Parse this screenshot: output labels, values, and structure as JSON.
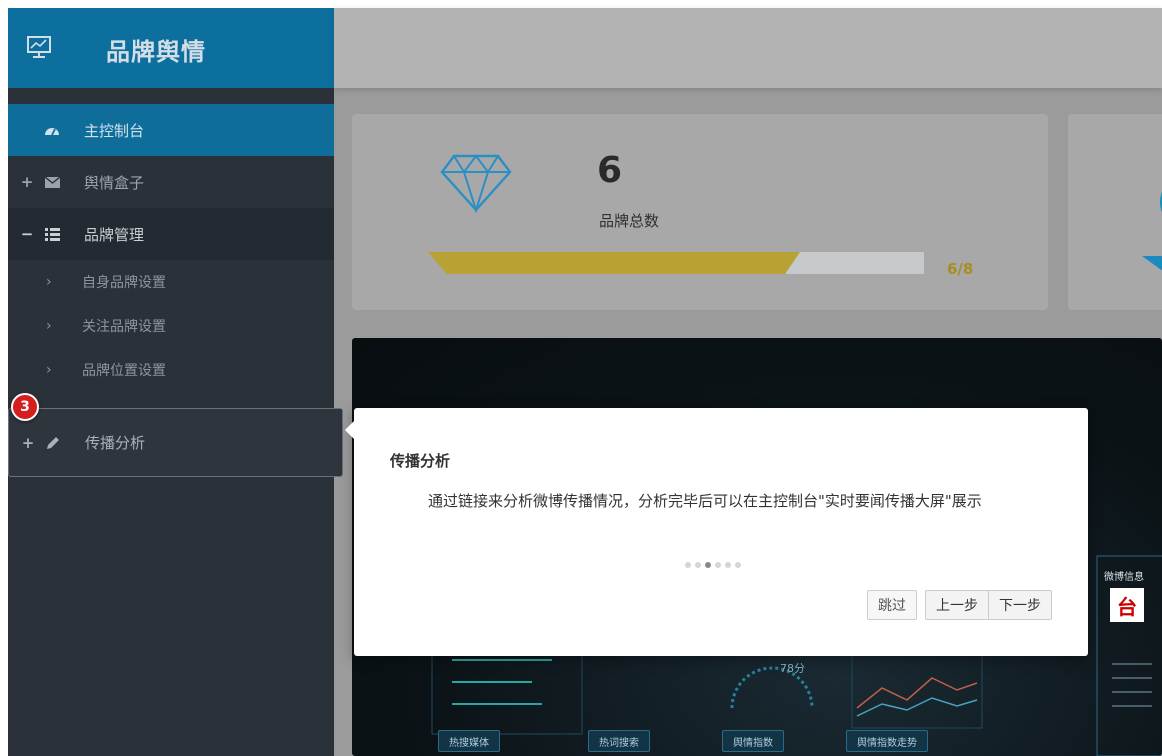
{
  "sidebar": {
    "brand_title": "品牌舆情",
    "items": [
      {
        "label": "主控制台",
        "icon": "dashboard-icon",
        "state": "active"
      },
      {
        "label": "舆情盒子",
        "icon": "envelope-icon",
        "toggle": "+"
      },
      {
        "label": "品牌管理",
        "icon": "list-icon",
        "toggle": "−",
        "state": "open"
      }
    ],
    "subitems": [
      "自身品牌设置",
      "关注品牌设置",
      "品牌位置设置"
    ],
    "highlighted_item": {
      "label": "传播分析",
      "icon": "pencil-icon",
      "toggle": "+"
    }
  },
  "stats": {
    "brand_count": "6",
    "brand_count_label": "品牌总数",
    "progress_ratio": "6/8",
    "progress_fraction": 0.75,
    "progress_color": "#b8a234"
  },
  "dashboard": {
    "weibo_title": "微博信息",
    "weibo_logo": "台",
    "metric": "78分",
    "panels": [
      "热搜媒体",
      "热词搜索",
      "舆情指数",
      "舆情指数走势"
    ]
  },
  "tour": {
    "step_badge": "3",
    "title": "传播分析",
    "body": "通过链接来分析微博传播情况，分析完毕后可以在主控制台\"实时要闻传播大屏\"展示",
    "total_steps": 6,
    "current_step": 3,
    "buttons": {
      "skip": "跳过",
      "prev": "上一步",
      "next": "下一步"
    }
  },
  "colors": {
    "sidebar_bg": "#2b3138",
    "brand_bar": "#0d6f9e",
    "active_item": "#0f6e99",
    "badge": "#d71e1e",
    "accent_blue": "#1e8ac0"
  }
}
